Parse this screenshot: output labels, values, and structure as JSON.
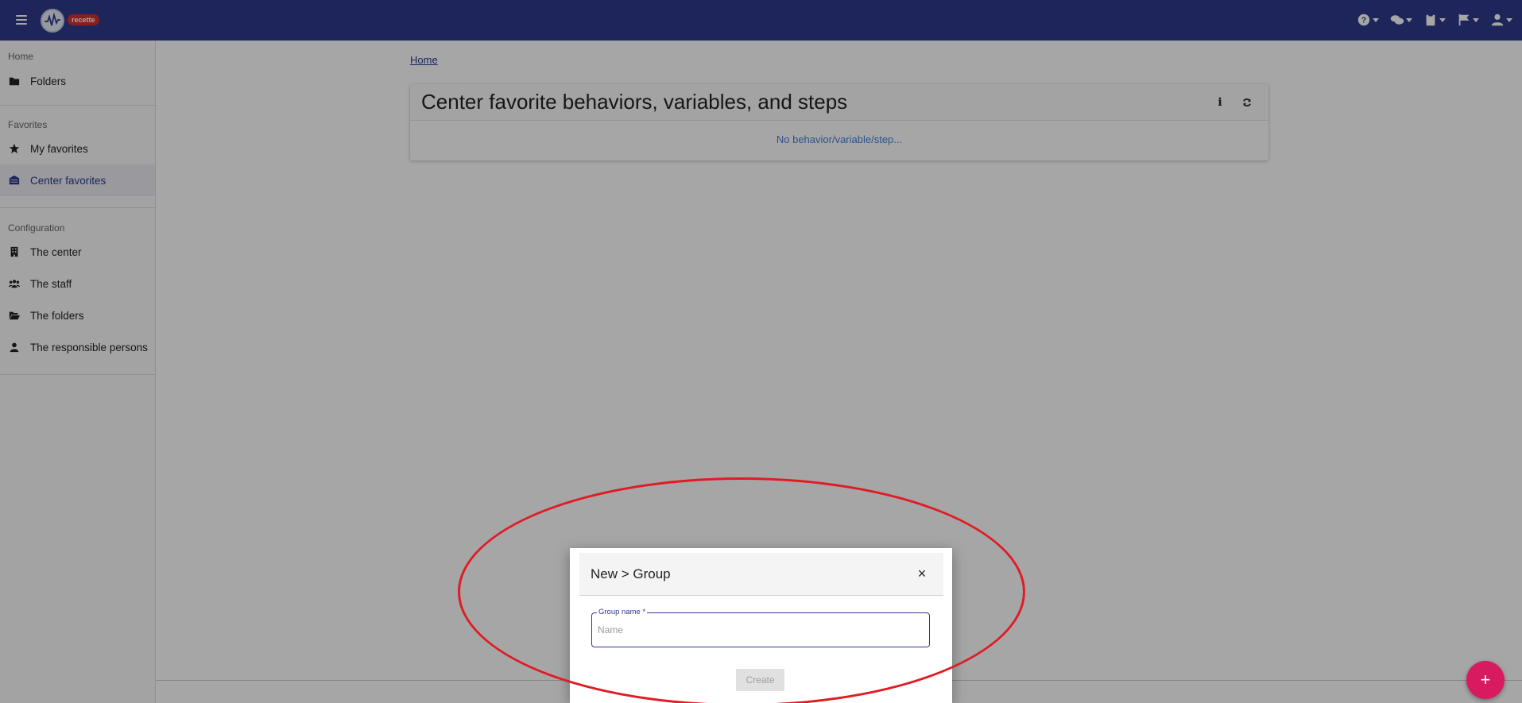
{
  "topbar": {
    "env_badge": "recette",
    "icons": [
      "help-icon",
      "chat-icon",
      "clipboard-icon",
      "flag-icon",
      "user-icon"
    ]
  },
  "sidebar": {
    "sections": [
      {
        "title": "Home",
        "items": [
          {
            "label": "Folders",
            "icon": "folder-icon"
          }
        ]
      },
      {
        "title": "Favorites",
        "items": [
          {
            "label": "My favorites",
            "icon": "star-icon"
          },
          {
            "label": "Center favorites",
            "icon": "building-icon",
            "active": true
          }
        ]
      },
      {
        "title": "Configuration",
        "items": [
          {
            "label": "The center",
            "icon": "building-icon"
          },
          {
            "label": "The staff",
            "icon": "users-icon"
          },
          {
            "label": "The folders",
            "icon": "folder-open-icon"
          },
          {
            "label": "The responsible persons",
            "icon": "user-icon"
          }
        ]
      }
    ]
  },
  "main": {
    "breadcrumb": "Home",
    "card": {
      "title": "Center favorite behaviors, variables, and steps",
      "info_label": "i",
      "empty_text": "No behavior/variable/step..."
    }
  },
  "dialog": {
    "title": "New > Group",
    "close_label": "×",
    "field_label": "Group name *",
    "field_placeholder": "Name",
    "field_value": "",
    "create_label": "Create"
  },
  "fab": {
    "label": "+"
  },
  "colors": {
    "primary": "#2d3a8c",
    "accent": "#d81b60",
    "badge": "#d32f2f",
    "annotation": "#e01b24"
  }
}
